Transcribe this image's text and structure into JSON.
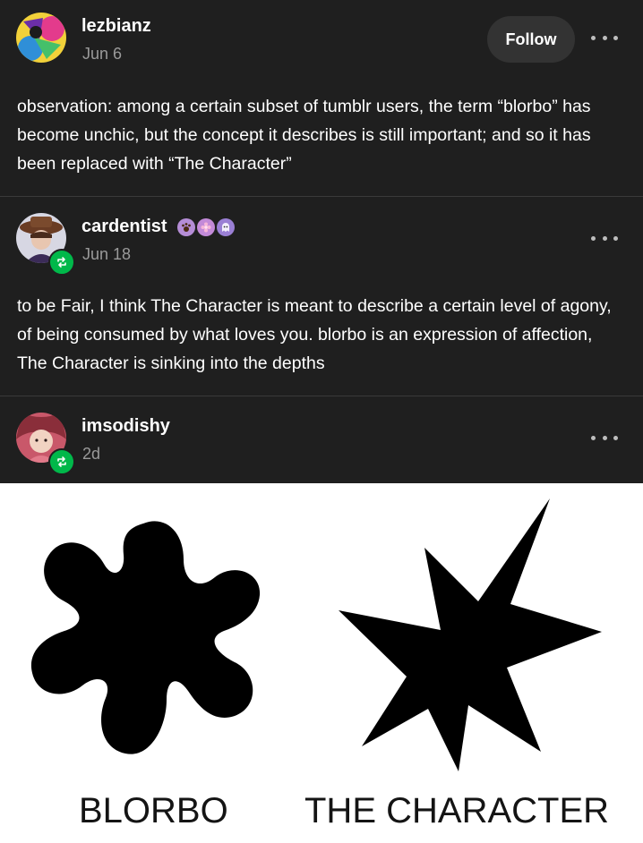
{
  "posts": [
    {
      "username": "lezbianz",
      "date": "Jun 6",
      "follow_label": "Follow",
      "text": "observation: among a certain subset of tumblr users, the term “blorbo” has become unchic, but the concept it describes is still important; and so it has been replaced with “The Character”"
    },
    {
      "username": "cardentist",
      "date": "Jun 18",
      "text": "to be Fair, I think The Character is meant to describe a certain level of agony, of being consumed by what loves you. blorbo is an expression of affection, The Character is sinking into the depths"
    },
    {
      "username": "imsodishy",
      "date": "2d"
    }
  ],
  "image": {
    "left_caption": "BLORBO",
    "right_caption": "THE CHARACTER"
  },
  "colors": {
    "background": "#1f1f1f",
    "reblog_green": "#00b84a",
    "follow_button": "#333333"
  }
}
